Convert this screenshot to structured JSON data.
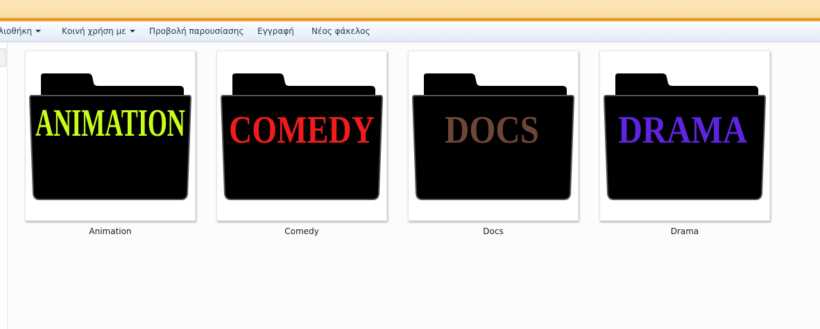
{
  "toolbar": {
    "library": "λιοθήκη",
    "share_with": "Κοινή χρήση με",
    "slideshow": "Προβολή παρουσίασης",
    "burn": "Εγγραφή",
    "new_folder": "Νέος φάκελος"
  },
  "items": [
    {
      "name": "Animation",
      "art_text": "ANIMATION",
      "art_color": "#c8ff1a",
      "icon": "folder-icon"
    },
    {
      "name": "Comedy",
      "art_text": "COMEDY",
      "art_color": "#ee1c1c",
      "icon": "folder-icon"
    },
    {
      "name": "Docs",
      "art_text": "DOCS",
      "art_color": "#6e4536",
      "icon": "folder-icon"
    },
    {
      "name": "Drama",
      "art_text": "DRAMA",
      "art_color": "#5e24e0",
      "icon": "folder-icon"
    }
  ],
  "colors": {
    "titlebar": "#fbe2ad",
    "titlebar_edge": "#e38e1c",
    "commandbar": "#eef3fa",
    "command_text": "#1e395b",
    "folder_body": "#000000"
  }
}
